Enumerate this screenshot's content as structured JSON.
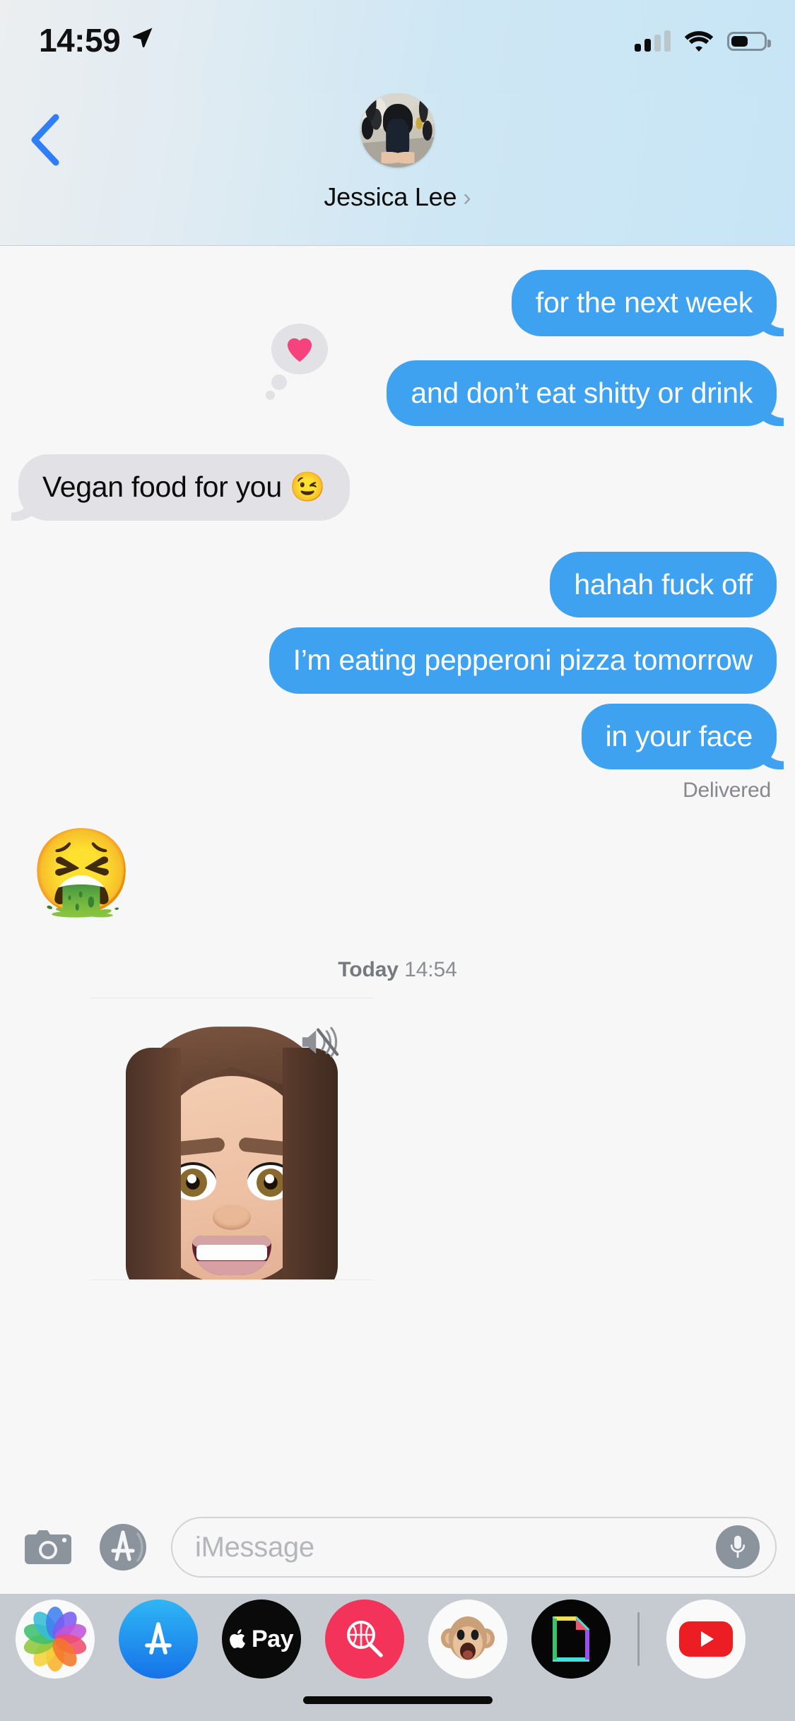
{
  "status_bar": {
    "time": "14:59",
    "location_icon": "location-arrow-icon",
    "cellular_icon": "signal-bars-icon",
    "wifi_icon": "wifi-icon",
    "battery_icon": "battery-icon",
    "battery_level_percent": 45,
    "signal_bars_filled": 2,
    "signal_bars_total": 4
  },
  "nav": {
    "back_icon": "chevron-left-icon",
    "contact_name": "Jessica Lee",
    "contact_chevron": "›",
    "avatar_icon": "contact-avatar"
  },
  "thread": {
    "messages": [
      {
        "id": "m1",
        "side": "out",
        "text": "for the next week",
        "tail": true,
        "reaction": null
      },
      {
        "id": "m2",
        "side": "out",
        "text": "and don’t eat shitty or drink",
        "tail": true,
        "reaction": "❤️"
      },
      {
        "id": "m3",
        "side": "in",
        "text": "Vegan food for you 😉",
        "tail": true,
        "reaction": null
      },
      {
        "id": "m4",
        "side": "out",
        "text": "hahah fuck off",
        "tail": false,
        "reaction": null
      },
      {
        "id": "m5",
        "side": "out",
        "text": "I’m eating pepperoni pizza tomorrow",
        "tail": false,
        "reaction": null
      },
      {
        "id": "m6",
        "side": "out",
        "text": "in your face",
        "tail": true,
        "reaction": null
      }
    ],
    "delivered_label": "Delivered",
    "big_emoji": "🤮",
    "daystamp_day": "Today",
    "daystamp_time": "14:54",
    "memoji": {
      "label": "memoji-video-message",
      "mute_icon": "speaker-muted-icon"
    }
  },
  "input_bar": {
    "camera_icon": "camera-icon",
    "appstore_icon": "app-store-icon",
    "placeholder": "iMessage",
    "value": "",
    "mic_icon": "microphone-icon"
  },
  "app_drawer": {
    "apps": [
      {
        "id": "photos",
        "label": "Photos",
        "icon": "photos-icon"
      },
      {
        "id": "appstore",
        "label": "App Store",
        "icon": "app-store-icon"
      },
      {
        "id": "applepay",
        "label": "Apple Pay",
        "icon": "apple-pay-icon",
        "text": "Pay"
      },
      {
        "id": "images",
        "label": "#images",
        "icon": "images-search-icon"
      },
      {
        "id": "animoji",
        "label": "Animoji",
        "icon": "animoji-monkey-icon"
      },
      {
        "id": "darkapp",
        "label": "Stickers",
        "icon": "rainbow-page-icon"
      },
      {
        "id": "youtube",
        "label": "YouTube",
        "icon": "youtube-icon"
      }
    ]
  },
  "colors": {
    "outgoing_bubble": "#3fa2f0",
    "incoming_bubble": "#e2e2e6",
    "thread_background": "#f7f7f7",
    "drawer_background": "#c6cad1",
    "accent_blue": "#2f7ef5"
  }
}
